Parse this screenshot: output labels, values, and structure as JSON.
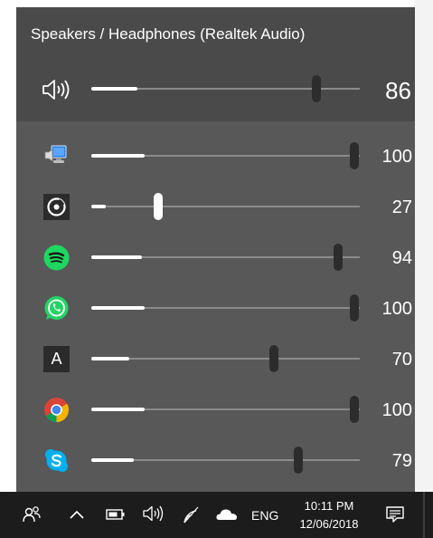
{
  "device": {
    "title": "Speakers / Headphones (Realtek Audio)"
  },
  "master": {
    "icon": "speaker-icon",
    "level": 86,
    "value": "86"
  },
  "apps": [
    {
      "name": "system-sounds",
      "icon": "system-sounds-icon",
      "level": 100,
      "value": "100"
    },
    {
      "name": "groove",
      "icon": "groove-music-icon",
      "level": 27,
      "value": "27",
      "active": true
    },
    {
      "name": "spotify",
      "icon": "spotify-icon",
      "level": 94,
      "value": "94"
    },
    {
      "name": "whatsapp",
      "icon": "whatsapp-icon",
      "level": 100,
      "value": "100"
    },
    {
      "name": "font-app",
      "icon": "font-app-icon",
      "label": "A",
      "level": 70,
      "value": "70"
    },
    {
      "name": "chrome",
      "icon": "chrome-icon",
      "level": 100,
      "value": "100"
    },
    {
      "name": "skype",
      "icon": "skype-icon",
      "level": 79,
      "value": "79"
    }
  ],
  "taskbar": {
    "people_icon": "people-icon",
    "chevron_icon": "chevron-up-icon",
    "battery_icon": "battery-icon",
    "volume_icon": "volume-icon",
    "network_icon": "wifi-icon",
    "onedrive_icon": "onedrive-icon",
    "language": "ENG",
    "time": "10:11 PM",
    "date": "12/06/2018",
    "notification_icon": "action-center-icon"
  },
  "colors": {
    "panel": "#585858",
    "device_section": "#4a4a4a",
    "taskbar": "#1c1c1c",
    "spotify": "#1ed760",
    "whatsapp": "#25d366",
    "skype": "#00aff0"
  }
}
